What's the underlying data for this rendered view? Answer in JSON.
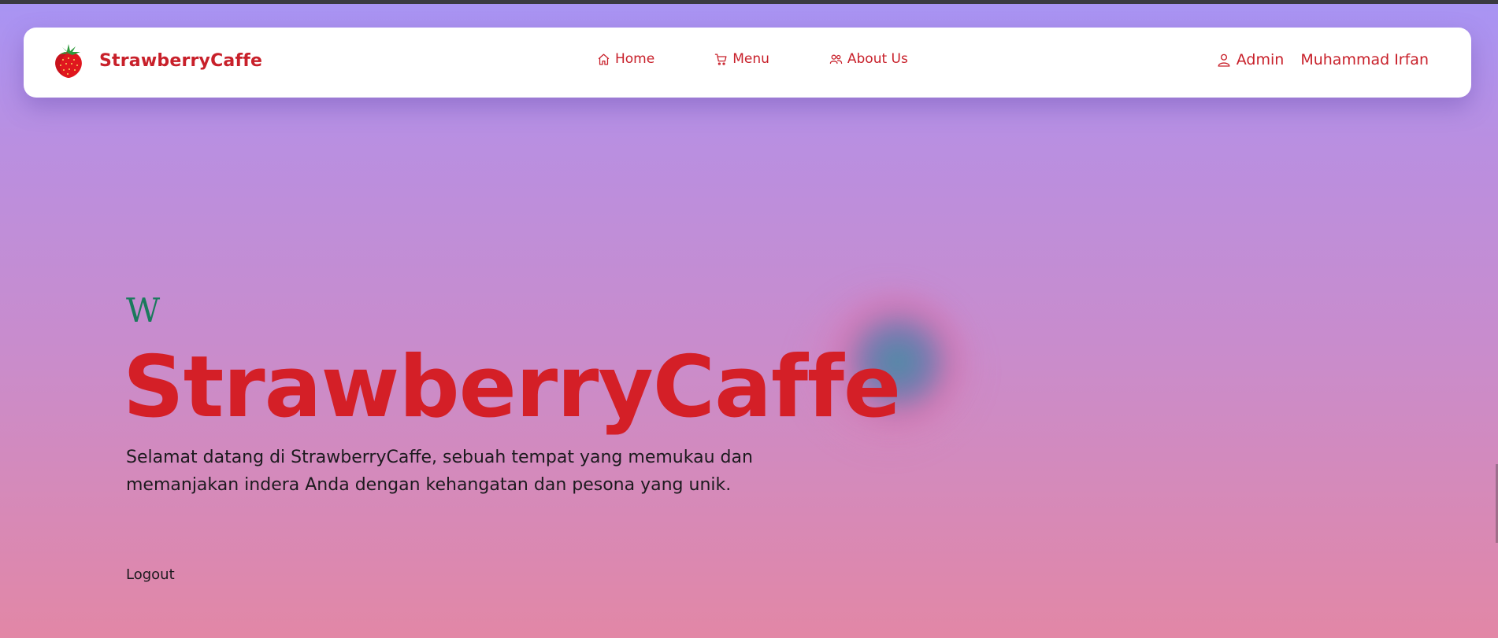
{
  "brand": {
    "name": "StrawberryCaffe",
    "logo_icon": "strawberry-icon"
  },
  "nav": {
    "items": [
      {
        "label": "Home",
        "icon": "home-icon"
      },
      {
        "label": "Menu",
        "icon": "cart-icon"
      },
      {
        "label": "About Us",
        "icon": "users-icon"
      }
    ]
  },
  "user": {
    "role_label": "Admin",
    "role_icon": "user-icon",
    "name": "Muhammad Irfan"
  },
  "hero": {
    "letter": "W",
    "title": "StrawberryCaffe",
    "description": "Selamat datang di StrawberryCaffe, sebuah tempat yang memukau dan memanjakan indera Anda dengan kehangatan dan pesona yang unik.",
    "logout_label": "Logout"
  },
  "colors": {
    "brand_red": "#c8202a",
    "title_red": "#d41f27",
    "accent_green": "#1a7a5c",
    "gradient_top": "#a894f4",
    "gradient_bottom": "#e287a6"
  }
}
